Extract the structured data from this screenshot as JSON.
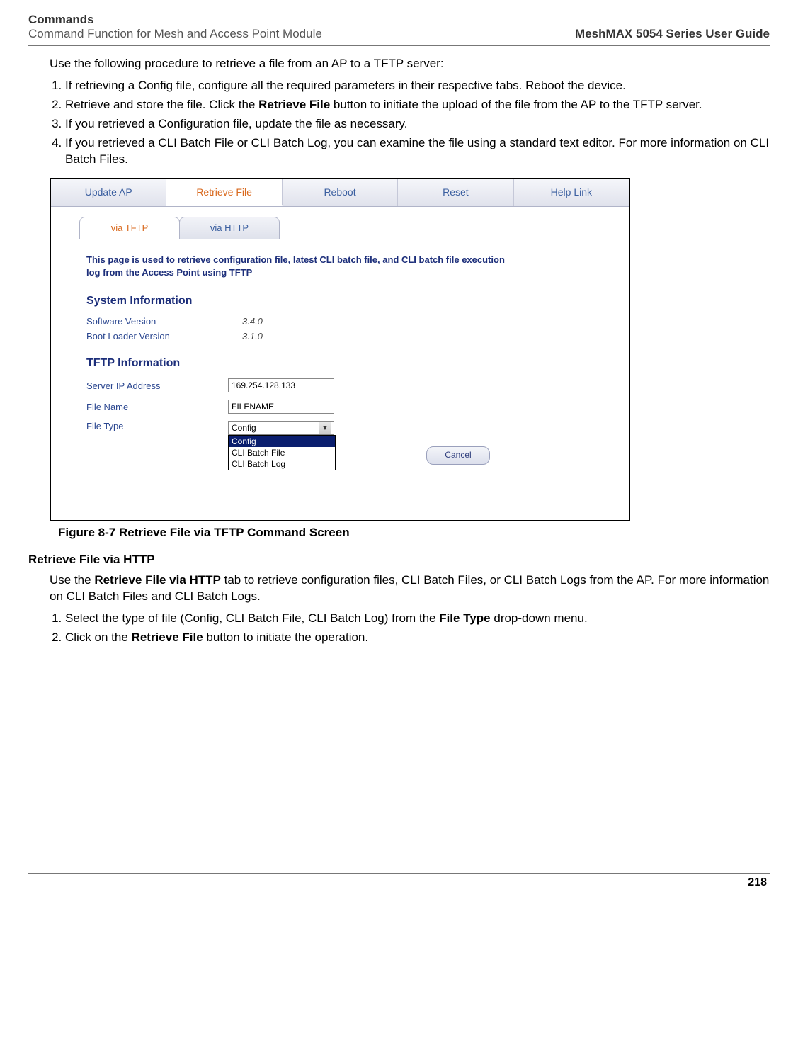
{
  "header": {
    "title": "Commands",
    "subtitle": "Command Function for Mesh and Access Point Module",
    "guide": "MeshMAX 5054 Series User Guide"
  },
  "intro": "Use the following procedure to retrieve a file from an AP to a TFTP server:",
  "steps1": {
    "s1": "If retrieving a Config file, configure all the required parameters in their respective tabs. Reboot the device.",
    "s2a": "Retrieve and store the file. Click the ",
    "s2b": "Retrieve File",
    "s2c": " button to initiate the upload of the file from the AP to the TFTP server.",
    "s3": "If you retrieved a Configuration file, update the file as necessary.",
    "s4": "If you retrieved a CLI Batch File or CLI Batch Log, you can examine the file using a standard text editor. For more information on CLI Batch Files."
  },
  "screenshot": {
    "topTabs": {
      "update": "Update AP",
      "retrieve": "Retrieve File",
      "reboot": "Reboot",
      "reset": "Reset",
      "help": "Help Link"
    },
    "subTabs": {
      "tftp": "via TFTP",
      "http": "via HTTP"
    },
    "desc": "This page is used to retrieve configuration file, latest CLI batch file, and CLI batch file execution log from the Access Point using TFTP",
    "sysTitle": "System Information",
    "softLabel": "Software Version",
    "softValue": "3.4.0",
    "bootLabel": "Boot Loader Version",
    "bootValue": "3.1.0",
    "tftpTitle": "TFTP Information",
    "serverLabel": "Server IP Address",
    "serverValue": "169.254.128.133",
    "fileNameLabel": "File Name",
    "fileNameValue": "FILENAME",
    "fileTypeLabel": "File Type",
    "fileTypeValue": "Config",
    "opt1": "Config",
    "opt2": "CLI Batch File",
    "opt3": "CLI Batch Log",
    "cancelBtn": "Cancel"
  },
  "figCaption": "Figure 8-7 Retrieve File via TFTP Command Screen",
  "httpHeading": "Retrieve File via HTTP",
  "httpPara": {
    "p1a": "Use the ",
    "p1b": "Retrieve File via HTTP",
    "p1c": " tab to retrieve configuration files, CLI Batch Files, or CLI Batch Logs from the AP. For more information on CLI Batch Files and CLI Batch Logs."
  },
  "steps2": {
    "s1a": "Select the type of file (Config, CLI Batch File, CLI Batch Log) from the ",
    "s1b": "File Type",
    "s1c": " drop-down menu.",
    "s2a": "Click on the ",
    "s2b": "Retrieve File",
    "s2c": " button to initiate the operation."
  },
  "pageNum": "218"
}
